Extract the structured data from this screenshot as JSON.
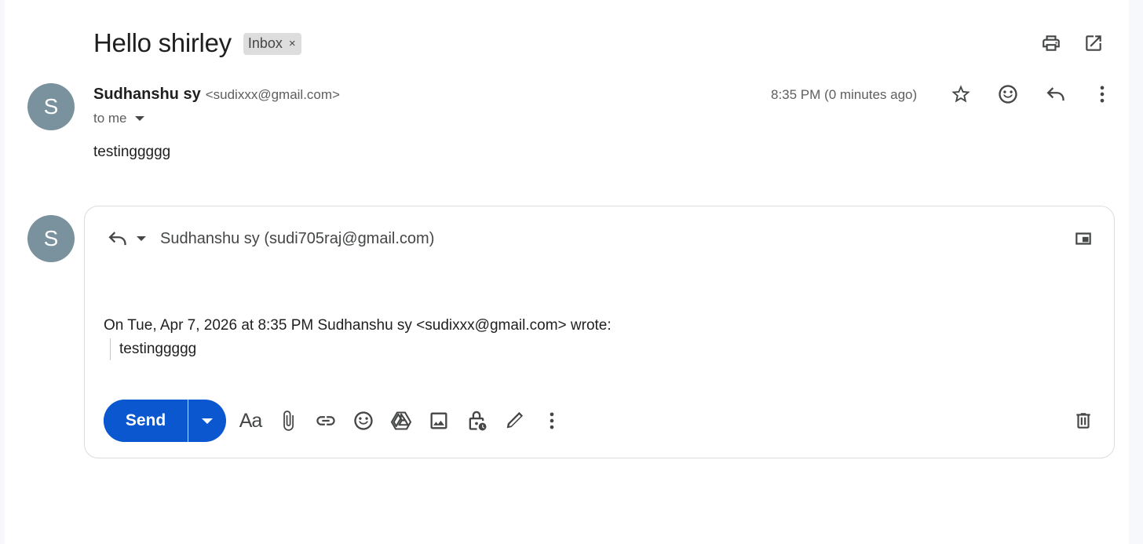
{
  "thread": {
    "subject": "Hello shirley",
    "label": "Inbox",
    "label_remove": "×"
  },
  "message": {
    "avatar_letter": "S",
    "sender_name": "Sudhanshu sy",
    "sender_email": "<sudixxx@gmail.com>",
    "recipient_summary": "to me",
    "timestamp": "8:35 PM (0 minutes ago)",
    "body": "testinggggg"
  },
  "reply": {
    "avatar_letter": "S",
    "recipients": "Sudhanshu sy (sudi705raj@gmail.com)",
    "quote_header": "On Tue, Apr 7, 2026 at 8:35 PM Sudhanshu sy <sudixxx@gmail.com> wrote:",
    "quoted_text": "testinggggg",
    "send_label": "Send",
    "format_label": "Aa"
  },
  "icons": [
    "print-icon",
    "open-new-window-icon",
    "star-icon",
    "emoji-icon",
    "reply-icon",
    "more-vert-icon",
    "popout-icon",
    "attach-icon",
    "link-icon",
    "drive-icon",
    "image-icon",
    "confidential-icon",
    "signature-icon",
    "trash-icon"
  ],
  "colors": {
    "accent": "#0b57d0",
    "avatar": "#7a919e",
    "label_chip": "#dddddd"
  }
}
